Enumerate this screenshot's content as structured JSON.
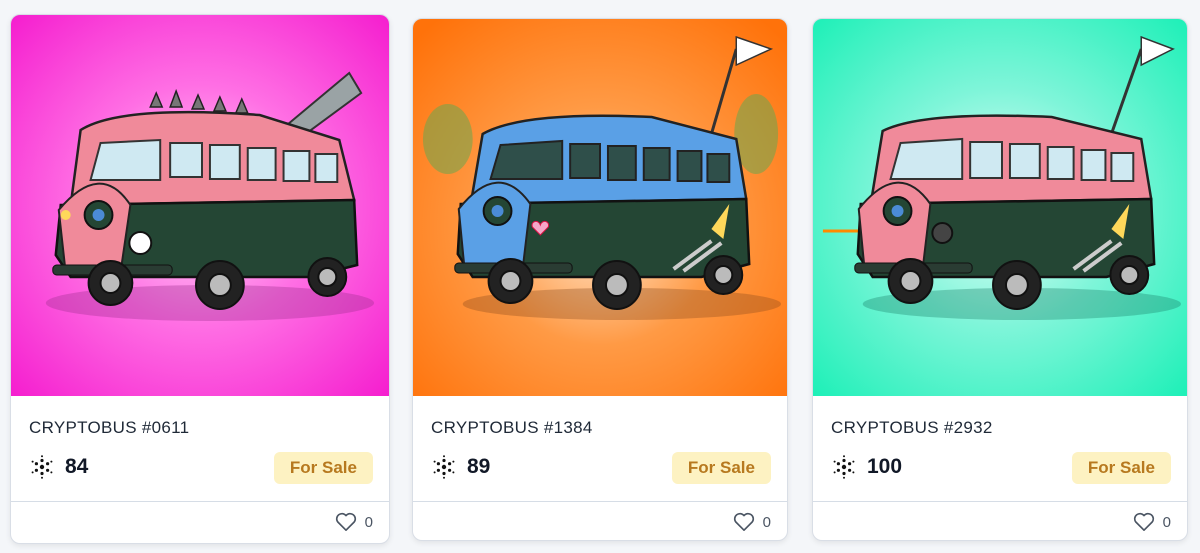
{
  "cards": [
    {
      "title": "CRYPTOBUS #0611",
      "price": "84",
      "status": "For Sale",
      "likes": "0",
      "background": "#ff33d6",
      "icon": "cardano-icon"
    },
    {
      "title": "CRYPTOBUS #1384",
      "price": "89",
      "status": "For Sale",
      "likes": "0",
      "background": "#ff7b12",
      "icon": "cardano-icon"
    },
    {
      "title": "CRYPTOBUS #2932",
      "price": "100",
      "status": "For Sale",
      "likes": "0",
      "background": "#22f5c0",
      "icon": "cardano-icon"
    }
  ],
  "colors": {
    "badge_bg": "#fdf2c2",
    "badge_text": "#b7791f",
    "bus_body": "#244634",
    "bus_top_pink": "#f08a9a",
    "bus_top_blue": "#5aa0e6"
  }
}
